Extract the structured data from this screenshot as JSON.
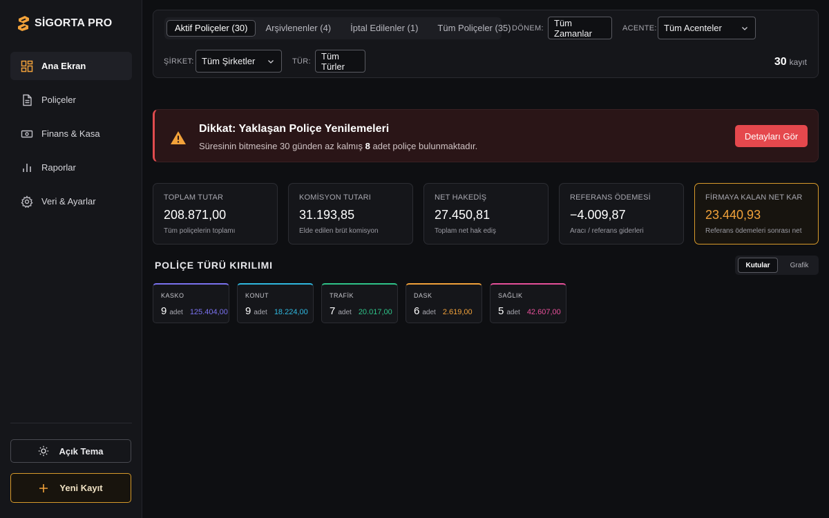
{
  "app": {
    "name": "SİGORTA PRO",
    "accent": "#f2a23a"
  },
  "sidebar": {
    "items": [
      {
        "label": "Ana Ekran",
        "icon": "dashboard-icon",
        "active": true
      },
      {
        "label": "Poliçeler",
        "icon": "document-icon",
        "active": false
      },
      {
        "label": "Finans & Kasa",
        "icon": "cash-icon",
        "active": false
      },
      {
        "label": "Raporlar",
        "icon": "bar-chart-icon",
        "active": false
      },
      {
        "label": "Veri & Ayarlar",
        "icon": "gear-icon",
        "active": false
      }
    ],
    "theme_button": "Açık Tema",
    "new_button": "Yeni Kayıt"
  },
  "filters": {
    "tabs": [
      {
        "label": "Aktif Poliçeler (30)",
        "active": true
      },
      {
        "label": "Arşivlenenler (4)",
        "active": false
      },
      {
        "label": "İptal Edilenler (1)",
        "active": false
      },
      {
        "label": "Tüm Poliçeler (35)",
        "active": false
      }
    ],
    "period_label": "DÖNEM:",
    "period_value": "Tüm Zamanlar",
    "agency_label": "ACENTE:",
    "agency_value": "Tüm Acenteler",
    "company_label": "ŞİRKET:",
    "company_value": "Tüm Şirketler",
    "type_label": "TÜR:",
    "type_value": "Tüm Türler",
    "record_count": "30",
    "record_unit": "kayıt"
  },
  "alert": {
    "title": "Dikkat: Yaklaşan Poliçe Yenilemeleri",
    "text_before": "Süresinin bitmesine 30 günden az kalmış",
    "count": "8",
    "text_after": "adet poliçe bulunmaktadır.",
    "button": "Detayları Gör",
    "color": "#e5484d"
  },
  "kpis": [
    {
      "label": "TOPLAM TUTAR",
      "value": "208.871,00",
      "sub": "Tüm poliçelerin toplamı"
    },
    {
      "label": "KOMİSYON TUTARI",
      "value": "31.193,85",
      "sub": "Elde edilen brüt komisyon"
    },
    {
      "label": "NET HAKEDİŞ",
      "value": "27.450,81",
      "sub": "Toplam net hak ediş"
    },
    {
      "label": "REFERANS ÖDEMESİ",
      "value": "−4.009,87",
      "sub": "Aracı / referans giderleri"
    },
    {
      "label": "FİRMAYA KALAN NET KAR",
      "value": "23.440,93",
      "sub": "Referans ödemeleri sonrası net"
    }
  ],
  "breakdown": {
    "title": "POLİÇE TÜRÜ KIRILIMI",
    "view_active": "Kutular",
    "view_other": "Grafik",
    "unit": "adet",
    "types": [
      {
        "label": "KASKO",
        "count": "9",
        "amount": "125.404,00",
        "color": "#7b72f0"
      },
      {
        "label": "KONUT",
        "count": "9",
        "amount": "18.224,00",
        "color": "#2fb8e0"
      },
      {
        "label": "TRAFİK",
        "count": "7",
        "amount": "20.017,00",
        "color": "#2fc489"
      },
      {
        "label": "DASK",
        "count": "6",
        "amount": "2.619,00",
        "color": "#f2a23a"
      },
      {
        "label": "SAĞLIK",
        "count": "5",
        "amount": "42.607,00",
        "color": "#e7509a"
      }
    ]
  }
}
